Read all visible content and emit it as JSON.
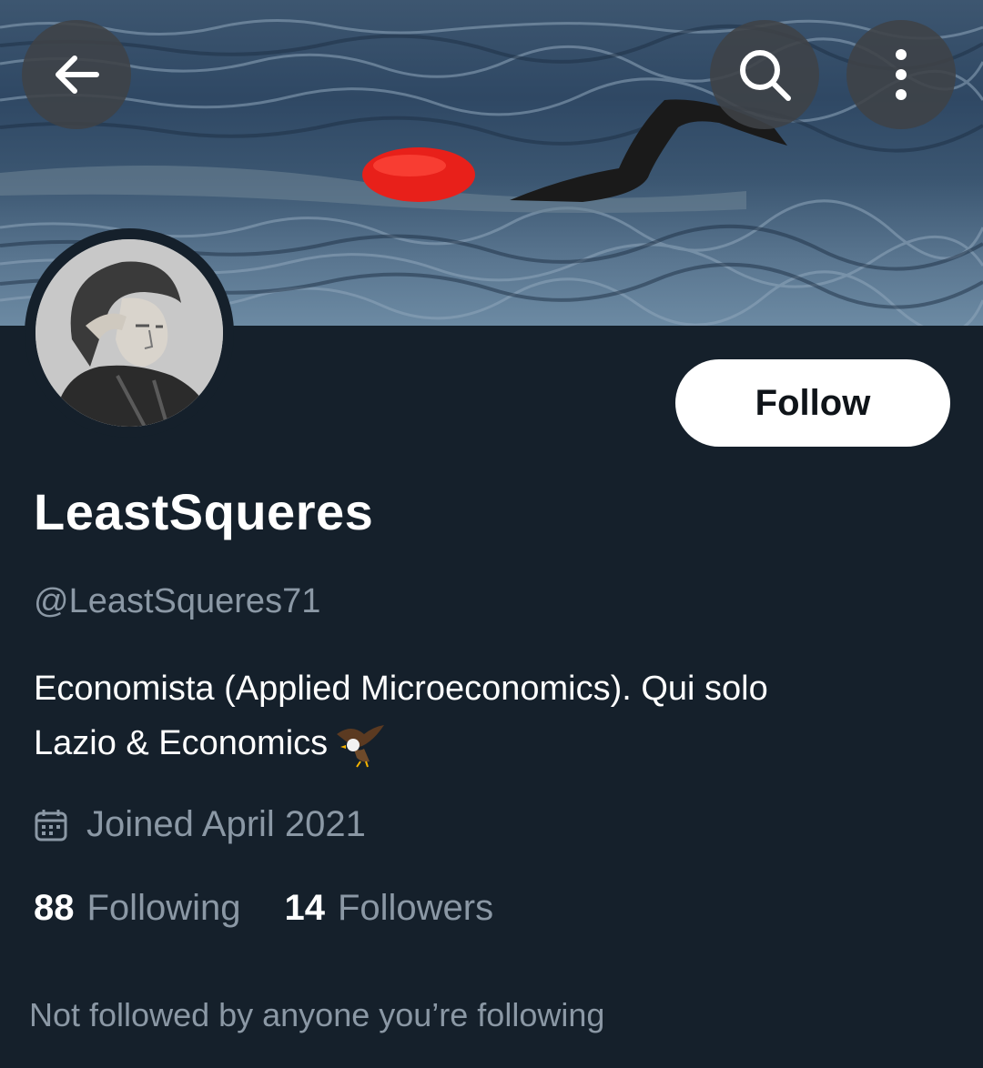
{
  "header": {
    "back_icon": "arrow-left-icon",
    "search_icon": "search-icon",
    "more_icon": "more-vertical-icon"
  },
  "profile": {
    "display_name": "LeastSqueres",
    "handle": "@LeastSqueres71",
    "bio_line1": "Economista (Applied Microeconomics). Qui solo",
    "bio_line2": "Lazio & Economics",
    "bio_emoji": "eagle-emoji",
    "joined": "Joined April 2021",
    "joined_icon": "calendar-icon",
    "following_count": "88",
    "following_label": "Following",
    "followers_count": "14",
    "followers_label": "Followers",
    "not_followed": "Not followed by anyone you’re following"
  },
  "actions": {
    "follow_label": "Follow"
  },
  "colors": {
    "background": "#15202b",
    "muted_text": "#8b98a5",
    "primary_text": "#ffffff",
    "button_bg": "#ffffff",
    "button_text": "#0f1419"
  }
}
